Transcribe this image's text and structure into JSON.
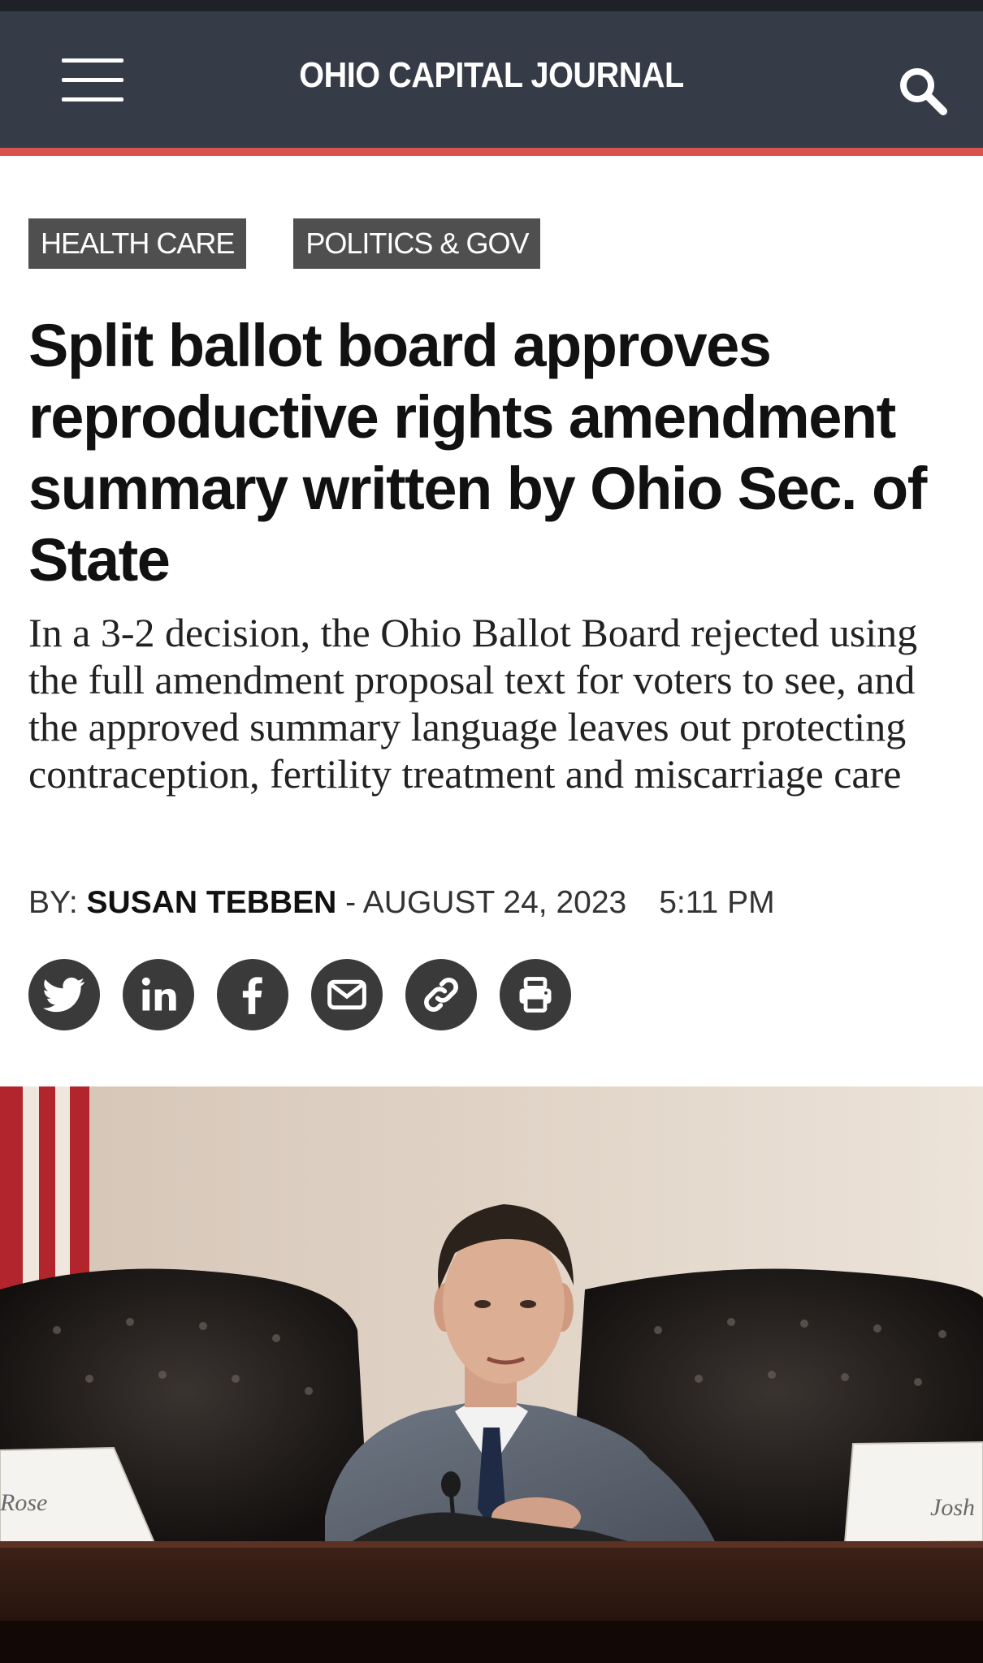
{
  "header": {
    "site_title": "OHIO CAPITAL JOURNAL",
    "menu_icon": "hamburger-menu-icon",
    "search_icon": "search-icon",
    "accent_color": "#d8544a",
    "bar_color": "#363c47"
  },
  "tags": [
    {
      "label": "HEALTH CARE"
    },
    {
      "label": "POLITICS & GOV"
    }
  ],
  "article": {
    "headline": "Split ballot board approves reproductive rights amendment summary written by Ohio Sec. of State",
    "dek": "In a 3-2 decision, the Ohio Ballot Board rejected using the full amendment proposal text for voters to see, and the approved summary language leaves out protecting contraception, fertility treatment and miscarriage care",
    "byline": {
      "prefix": "BY: ",
      "author": "SUSAN TEBBEN",
      "separator": " - ",
      "date": "AUGUST 24, 2023",
      "time": "5:11 PM"
    }
  },
  "share_icons": [
    "twitter-icon",
    "linkedin-icon",
    "facebook-icon",
    "email-icon",
    "link-icon",
    "print-icon"
  ],
  "photo": {
    "placard_left": "Rose",
    "placard_right": "Josh"
  }
}
